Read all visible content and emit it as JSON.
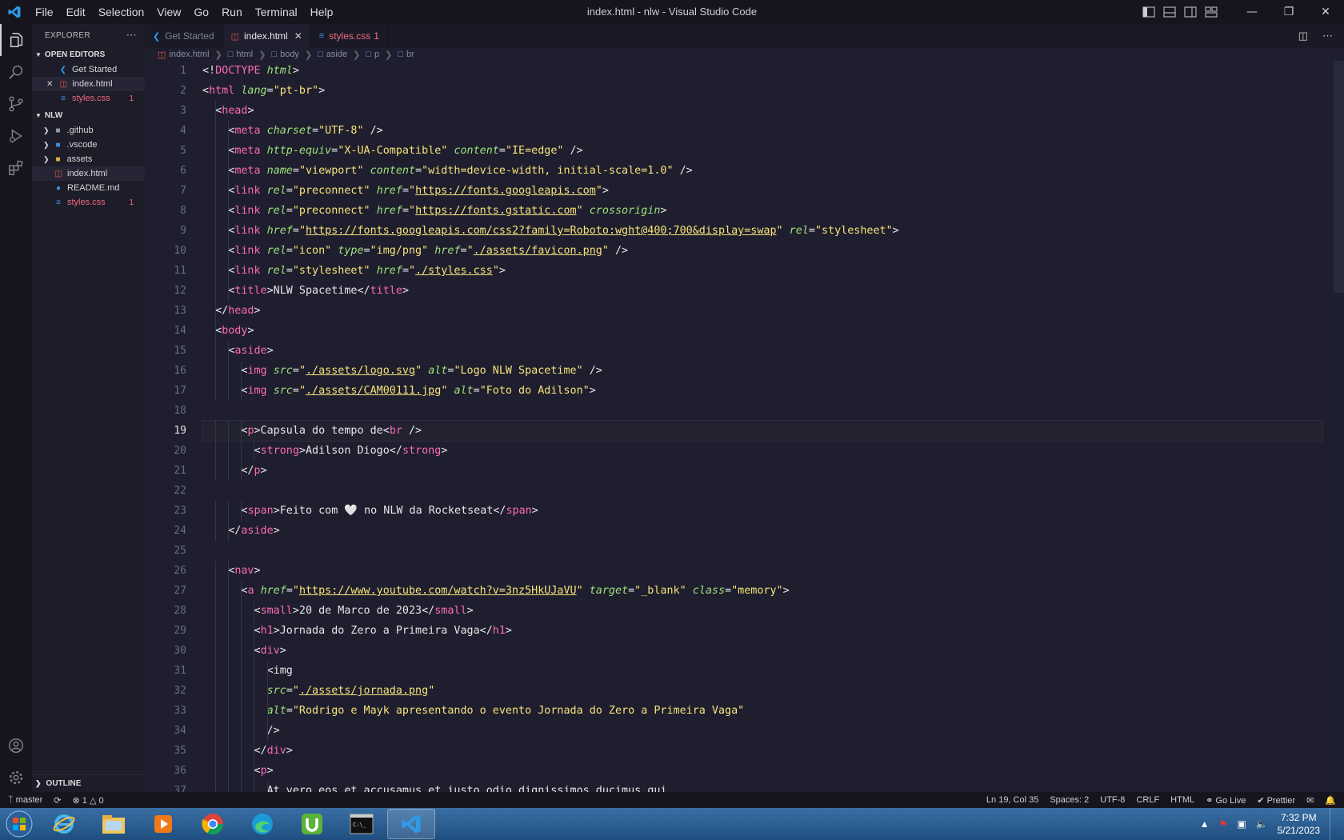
{
  "window": {
    "title": "index.html - nlw - Visual Studio Code",
    "menu": [
      "File",
      "Edit",
      "Selection",
      "View",
      "Go",
      "Run",
      "Terminal",
      "Help"
    ]
  },
  "sidebar": {
    "header": "EXPLORER",
    "open_editors_label": "OPEN EDITORS",
    "open_editors": [
      {
        "label": "Get Started",
        "icon": "vscode-icon"
      },
      {
        "label": "index.html",
        "icon": "html-icon"
      },
      {
        "label": "styles.css",
        "icon": "css-icon",
        "badge": "1"
      }
    ],
    "project_label": "NLW",
    "project_items": [
      {
        "label": ".github",
        "icon": "folder-icon"
      },
      {
        "label": ".vscode",
        "icon": "folder-icon"
      },
      {
        "label": "assets",
        "icon": "folder-icon"
      },
      {
        "label": "index.html",
        "icon": "html-icon"
      },
      {
        "label": "README.md",
        "icon": "info-icon"
      },
      {
        "label": "styles.css",
        "icon": "css-icon",
        "badge": "1"
      }
    ],
    "outline_label": "OUTLINE"
  },
  "tabs": [
    {
      "label": "Get Started"
    },
    {
      "label": "index.html"
    },
    {
      "label": "styles.css",
      "badge": "1"
    }
  ],
  "breadcrumb": [
    "index.html",
    "html",
    "body",
    "aside",
    "p",
    "br"
  ],
  "editor": {
    "current_line": 19,
    "lines": [
      "<!DOCTYPE html>",
      "<html lang=\"pt-br\">",
      "  <head>",
      "    <meta charset=\"UTF-8\" />",
      "    <meta http-equiv=\"X-UA-Compatible\" content=\"IE=edge\" />",
      "    <meta name=\"viewport\" content=\"width=device-width, initial-scale=1.0\" />",
      "    <link rel=\"preconnect\" href=\"https://fonts.googleapis.com\">",
      "    <link rel=\"preconnect\" href=\"https://fonts.gstatic.com\" crossorigin>",
      "    <link href=\"https://fonts.googleapis.com/css2?family=Roboto:wght@400;700&display=swap\" rel=\"stylesheet\">",
      "    <link rel=\"icon\" type=\"img/png\" href=\"./assets/favicon.png\" />",
      "    <link rel=\"stylesheet\" href=\"./styles.css\">",
      "    <title>NLW Spacetime</title>",
      "  </head>",
      "  <body>",
      "    <aside>",
      "      <img src=\"./assets/logo.svg\" alt=\"Logo NLW Spacetime\" />",
      "      <img src=\"./assets/CAM00111.jpg\" alt=\"Foto do Adilson\">",
      "",
      "      <p>Capsula do tempo de<br />",
      "        <strong>Adilson Diogo</strong>",
      "      </p>",
      "",
      "      <span>Feito com 🤍 no NLW da Rocketseat</span>",
      "    </aside>",
      "",
      "    <nav>",
      "      <a href=\"https://www.youtube.com/watch?v=3nz5HkUJaVU\" target=\"_blank\" class=\"memory\">",
      "        <small>20 de Marco de 2023</small>",
      "        <h1>Jornada do Zero a Primeira Vaga</h1>",
      "        <div>",
      "          <img",
      "          src=\"./assets/jornada.png\"",
      "          alt=\"Rodrigo e Mayk apresentando o evento Jornada do Zero a Primeira Vaga\"",
      "          />",
      "        </div>",
      "        <p>",
      "          At vero eos et accusamus et iusto odio dignissimos ducimus qui"
    ]
  },
  "statusbar": {
    "branch": "master",
    "errors": "1",
    "warnings": "0",
    "position": "Ln 19, Col 35",
    "spaces": "Spaces: 2",
    "encoding": "UTF-8",
    "eol": "CRLF",
    "language": "HTML",
    "golive": "Go Live",
    "prettier": "Prettier"
  },
  "taskbar": {
    "apps": [
      "internet-explorer",
      "file-explorer",
      "media-player",
      "chrome",
      "edge",
      "utorrent",
      "command-prompt",
      "vscode"
    ],
    "time": "7:32 PM",
    "date": "5/21/2023"
  },
  "colors": {
    "tag": "#ff6ab5",
    "attribute": "#9ee37d",
    "string": "#f7e27b",
    "error": "#f06a7c"
  }
}
